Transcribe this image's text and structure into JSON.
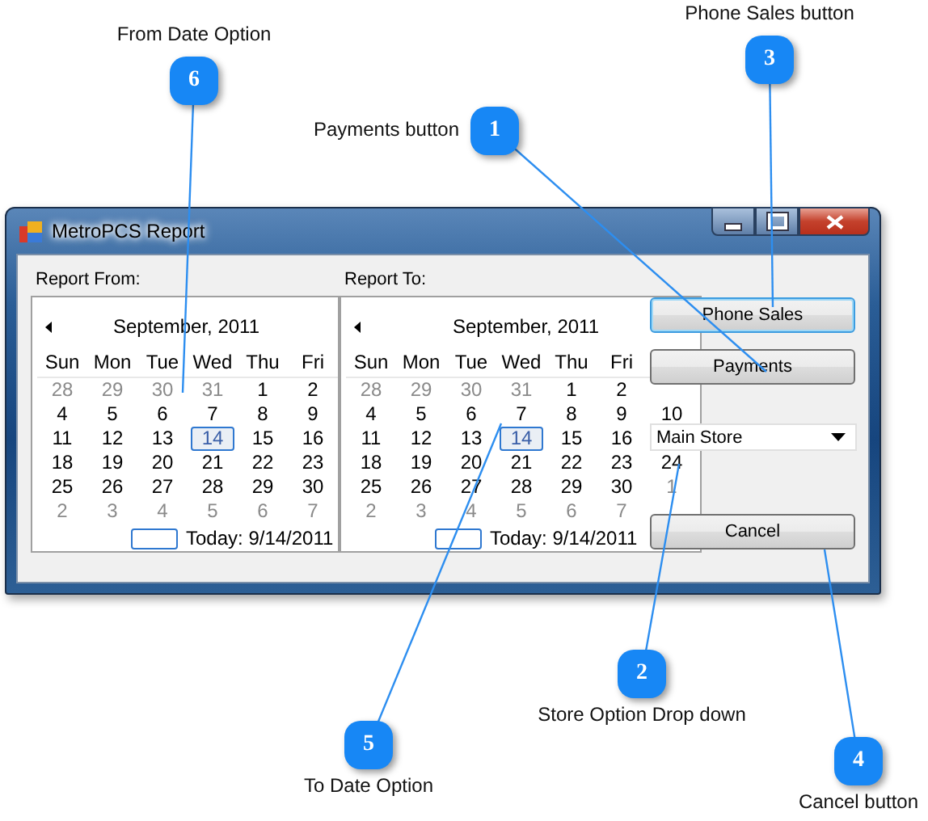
{
  "window": {
    "title": "MetroPCS Report"
  },
  "report_from": {
    "label": "Report From:",
    "month": "September, 2011",
    "weekdays": [
      "Sun",
      "Mon",
      "Tue",
      "Wed",
      "Thu",
      "Fri"
    ],
    "weeks": [
      [
        {
          "day": "28",
          "muted": true,
          "selected": false
        },
        {
          "day": "29",
          "muted": true,
          "selected": false
        },
        {
          "day": "30",
          "muted": true,
          "selected": false
        },
        {
          "day": "31",
          "muted": true,
          "selected": false
        },
        {
          "day": "1",
          "muted": false,
          "selected": false
        },
        {
          "day": "2",
          "muted": false,
          "selected": false
        }
      ],
      [
        {
          "day": "4",
          "muted": false,
          "selected": false
        },
        {
          "day": "5",
          "muted": false,
          "selected": false
        },
        {
          "day": "6",
          "muted": false,
          "selected": false
        },
        {
          "day": "7",
          "muted": false,
          "selected": false
        },
        {
          "day": "8",
          "muted": false,
          "selected": false
        },
        {
          "day": "9",
          "muted": false,
          "selected": false
        }
      ],
      [
        {
          "day": "11",
          "muted": false,
          "selected": false
        },
        {
          "day": "12",
          "muted": false,
          "selected": false
        },
        {
          "day": "13",
          "muted": false,
          "selected": false
        },
        {
          "day": "14",
          "muted": false,
          "selected": true
        },
        {
          "day": "15",
          "muted": false,
          "selected": false
        },
        {
          "day": "16",
          "muted": false,
          "selected": false
        }
      ],
      [
        {
          "day": "18",
          "muted": false,
          "selected": false
        },
        {
          "day": "19",
          "muted": false,
          "selected": false
        },
        {
          "day": "20",
          "muted": false,
          "selected": false
        },
        {
          "day": "21",
          "muted": false,
          "selected": false
        },
        {
          "day": "22",
          "muted": false,
          "selected": false
        },
        {
          "day": "23",
          "muted": false,
          "selected": false
        }
      ],
      [
        {
          "day": "25",
          "muted": false,
          "selected": false
        },
        {
          "day": "26",
          "muted": false,
          "selected": false
        },
        {
          "day": "27",
          "muted": false,
          "selected": false
        },
        {
          "day": "28",
          "muted": false,
          "selected": false
        },
        {
          "day": "29",
          "muted": false,
          "selected": false
        },
        {
          "day": "30",
          "muted": false,
          "selected": false
        }
      ],
      [
        {
          "day": "2",
          "muted": true,
          "selected": false
        },
        {
          "day": "3",
          "muted": true,
          "selected": false
        },
        {
          "day": "4",
          "muted": true,
          "selected": false
        },
        {
          "day": "5",
          "muted": true,
          "selected": false
        },
        {
          "day": "6",
          "muted": true,
          "selected": false
        },
        {
          "day": "7",
          "muted": true,
          "selected": false
        }
      ]
    ],
    "today": "Today: 9/14/2011"
  },
  "report_to": {
    "label": "Report To:",
    "month": "September, 2011",
    "weekdays": [
      "Sun",
      "Mon",
      "Tue",
      "Wed",
      "Thu",
      "Fri"
    ],
    "weeks": [
      [
        {
          "day": "28",
          "muted": true,
          "selected": false
        },
        {
          "day": "29",
          "muted": true,
          "selected": false
        },
        {
          "day": "30",
          "muted": true,
          "selected": false
        },
        {
          "day": "31",
          "muted": true,
          "selected": false
        },
        {
          "day": "1",
          "muted": false,
          "selected": false
        },
        {
          "day": "2",
          "muted": false,
          "selected": false
        }
      ],
      [
        {
          "day": "4",
          "muted": false,
          "selected": false
        },
        {
          "day": "5",
          "muted": false,
          "selected": false
        },
        {
          "day": "6",
          "muted": false,
          "selected": false
        },
        {
          "day": "7",
          "muted": false,
          "selected": false
        },
        {
          "day": "8",
          "muted": false,
          "selected": false
        },
        {
          "day": "9",
          "muted": false,
          "selected": false
        },
        {
          "day": "10",
          "muted": false,
          "selected": false
        }
      ],
      [
        {
          "day": "11",
          "muted": false,
          "selected": false
        },
        {
          "day": "12",
          "muted": false,
          "selected": false
        },
        {
          "day": "13",
          "muted": false,
          "selected": false
        },
        {
          "day": "14",
          "muted": false,
          "selected": true
        },
        {
          "day": "15",
          "muted": false,
          "selected": false
        },
        {
          "day": "16",
          "muted": false,
          "selected": false
        }
      ],
      [
        {
          "day": "18",
          "muted": false,
          "selected": false
        },
        {
          "day": "19",
          "muted": false,
          "selected": false
        },
        {
          "day": "20",
          "muted": false,
          "selected": false
        },
        {
          "day": "21",
          "muted": false,
          "selected": false
        },
        {
          "day": "22",
          "muted": false,
          "selected": false
        },
        {
          "day": "23",
          "muted": false,
          "selected": false
        },
        {
          "day": "24",
          "muted": false,
          "selected": false
        }
      ],
      [
        {
          "day": "25",
          "muted": false,
          "selected": false
        },
        {
          "day": "26",
          "muted": false,
          "selected": false
        },
        {
          "day": "27",
          "muted": false,
          "selected": false
        },
        {
          "day": "28",
          "muted": false,
          "selected": false
        },
        {
          "day": "29",
          "muted": false,
          "selected": false
        },
        {
          "day": "30",
          "muted": false,
          "selected": false
        },
        {
          "day": "1",
          "muted": true,
          "selected": false
        }
      ],
      [
        {
          "day": "2",
          "muted": true,
          "selected": false
        },
        {
          "day": "3",
          "muted": true,
          "selected": false
        },
        {
          "day": "4",
          "muted": true,
          "selected": false
        },
        {
          "day": "5",
          "muted": true,
          "selected": false
        },
        {
          "day": "6",
          "muted": true,
          "selected": false
        },
        {
          "day": "7",
          "muted": true,
          "selected": false
        }
      ]
    ],
    "today": "Today: 9/14/2011"
  },
  "buttons": [
    {
      "label": "Phone Sales",
      "focused": true
    },
    {
      "label": "Payments",
      "focused": false
    }
  ],
  "store_dropdown": {
    "value": "Main Store"
  },
  "cancel_button": {
    "label": "Cancel"
  },
  "callouts": [
    {
      "number": "1",
      "label": "Payments button"
    },
    {
      "number": "2",
      "label": "Store Option Drop down"
    },
    {
      "number": "3",
      "label": "Phone Sales button"
    },
    {
      "number": "4",
      "label": "Cancel button"
    },
    {
      "number": "5",
      "label": "To Date Option"
    },
    {
      "number": "6",
      "label": "From Date Option"
    }
  ]
}
